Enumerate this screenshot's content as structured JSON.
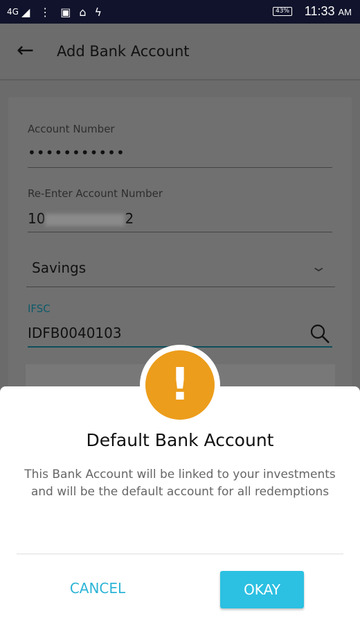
{
  "status_bar": {
    "network": "4G",
    "battery": "43%",
    "time": "11:33",
    "ampm": "AM"
  },
  "toolbar": {
    "title": "Add Bank Account"
  },
  "form": {
    "account_number_label": "Account Number",
    "account_number_value": "•••••••••••",
    "reenter_label": "Re-Enter Account Number",
    "reenter_prefix": "10",
    "reenter_suffix": "2",
    "account_type": "Savings",
    "ifsc_label": "IFSC",
    "ifsc_value": "IDFB0040103"
  },
  "dialog": {
    "title": "Default Bank Account",
    "message": "This Bank Account will be linked to your investments and will be the default account for all redemptions",
    "cancel_label": "CANCEL",
    "okay_label": "OKAY",
    "icon": "exclamation-icon",
    "accent": "#ec9d1b",
    "button_color": "#2cc0e2"
  }
}
